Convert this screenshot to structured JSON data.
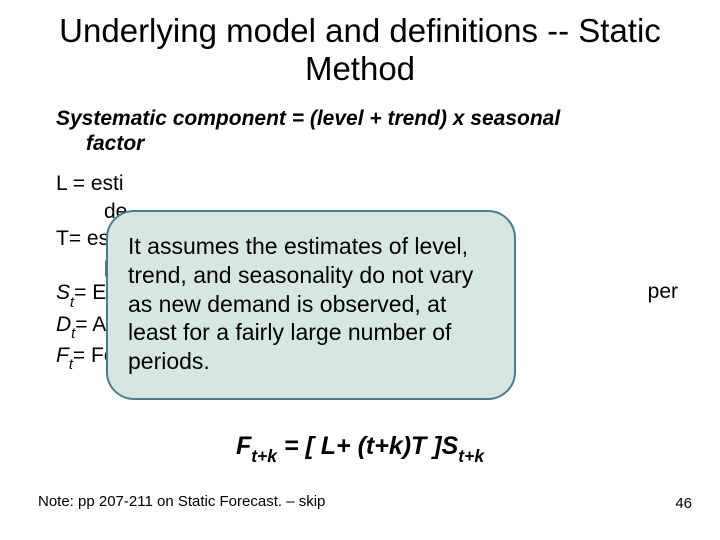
{
  "title": "Underlying model and definitions -- Static Method",
  "subhead_line1": "Systematic component = (level + trend)  x  seasonal",
  "subhead_line2": "factor",
  "defs": {
    "L1": "L = esti",
    "L1b": "de",
    "T1": "T= est",
    "T1b": "pe",
    "St": "S",
    "St_sub": "t",
    "St_after": "= Es",
    "Dt": "D",
    "Dt_sub": "t",
    "Dt_after": "= Ac",
    "Ft": "F",
    "Ft_sub": "t",
    "Ft_after": "= Fo"
  },
  "per_fragment": "per",
  "callout": "It assumes the estimates of level, trend, and seasonality do not vary as new demand is observed,  at least for a fairly large number of periods.",
  "formula": {
    "F": "F",
    "sub1": "t+k",
    "mid": " = [ L+ (t+k)T ]S",
    "sub2": "t+k"
  },
  "note": "Note: pp 207-211 on Static Forecast. – skip",
  "pagenum": "46"
}
